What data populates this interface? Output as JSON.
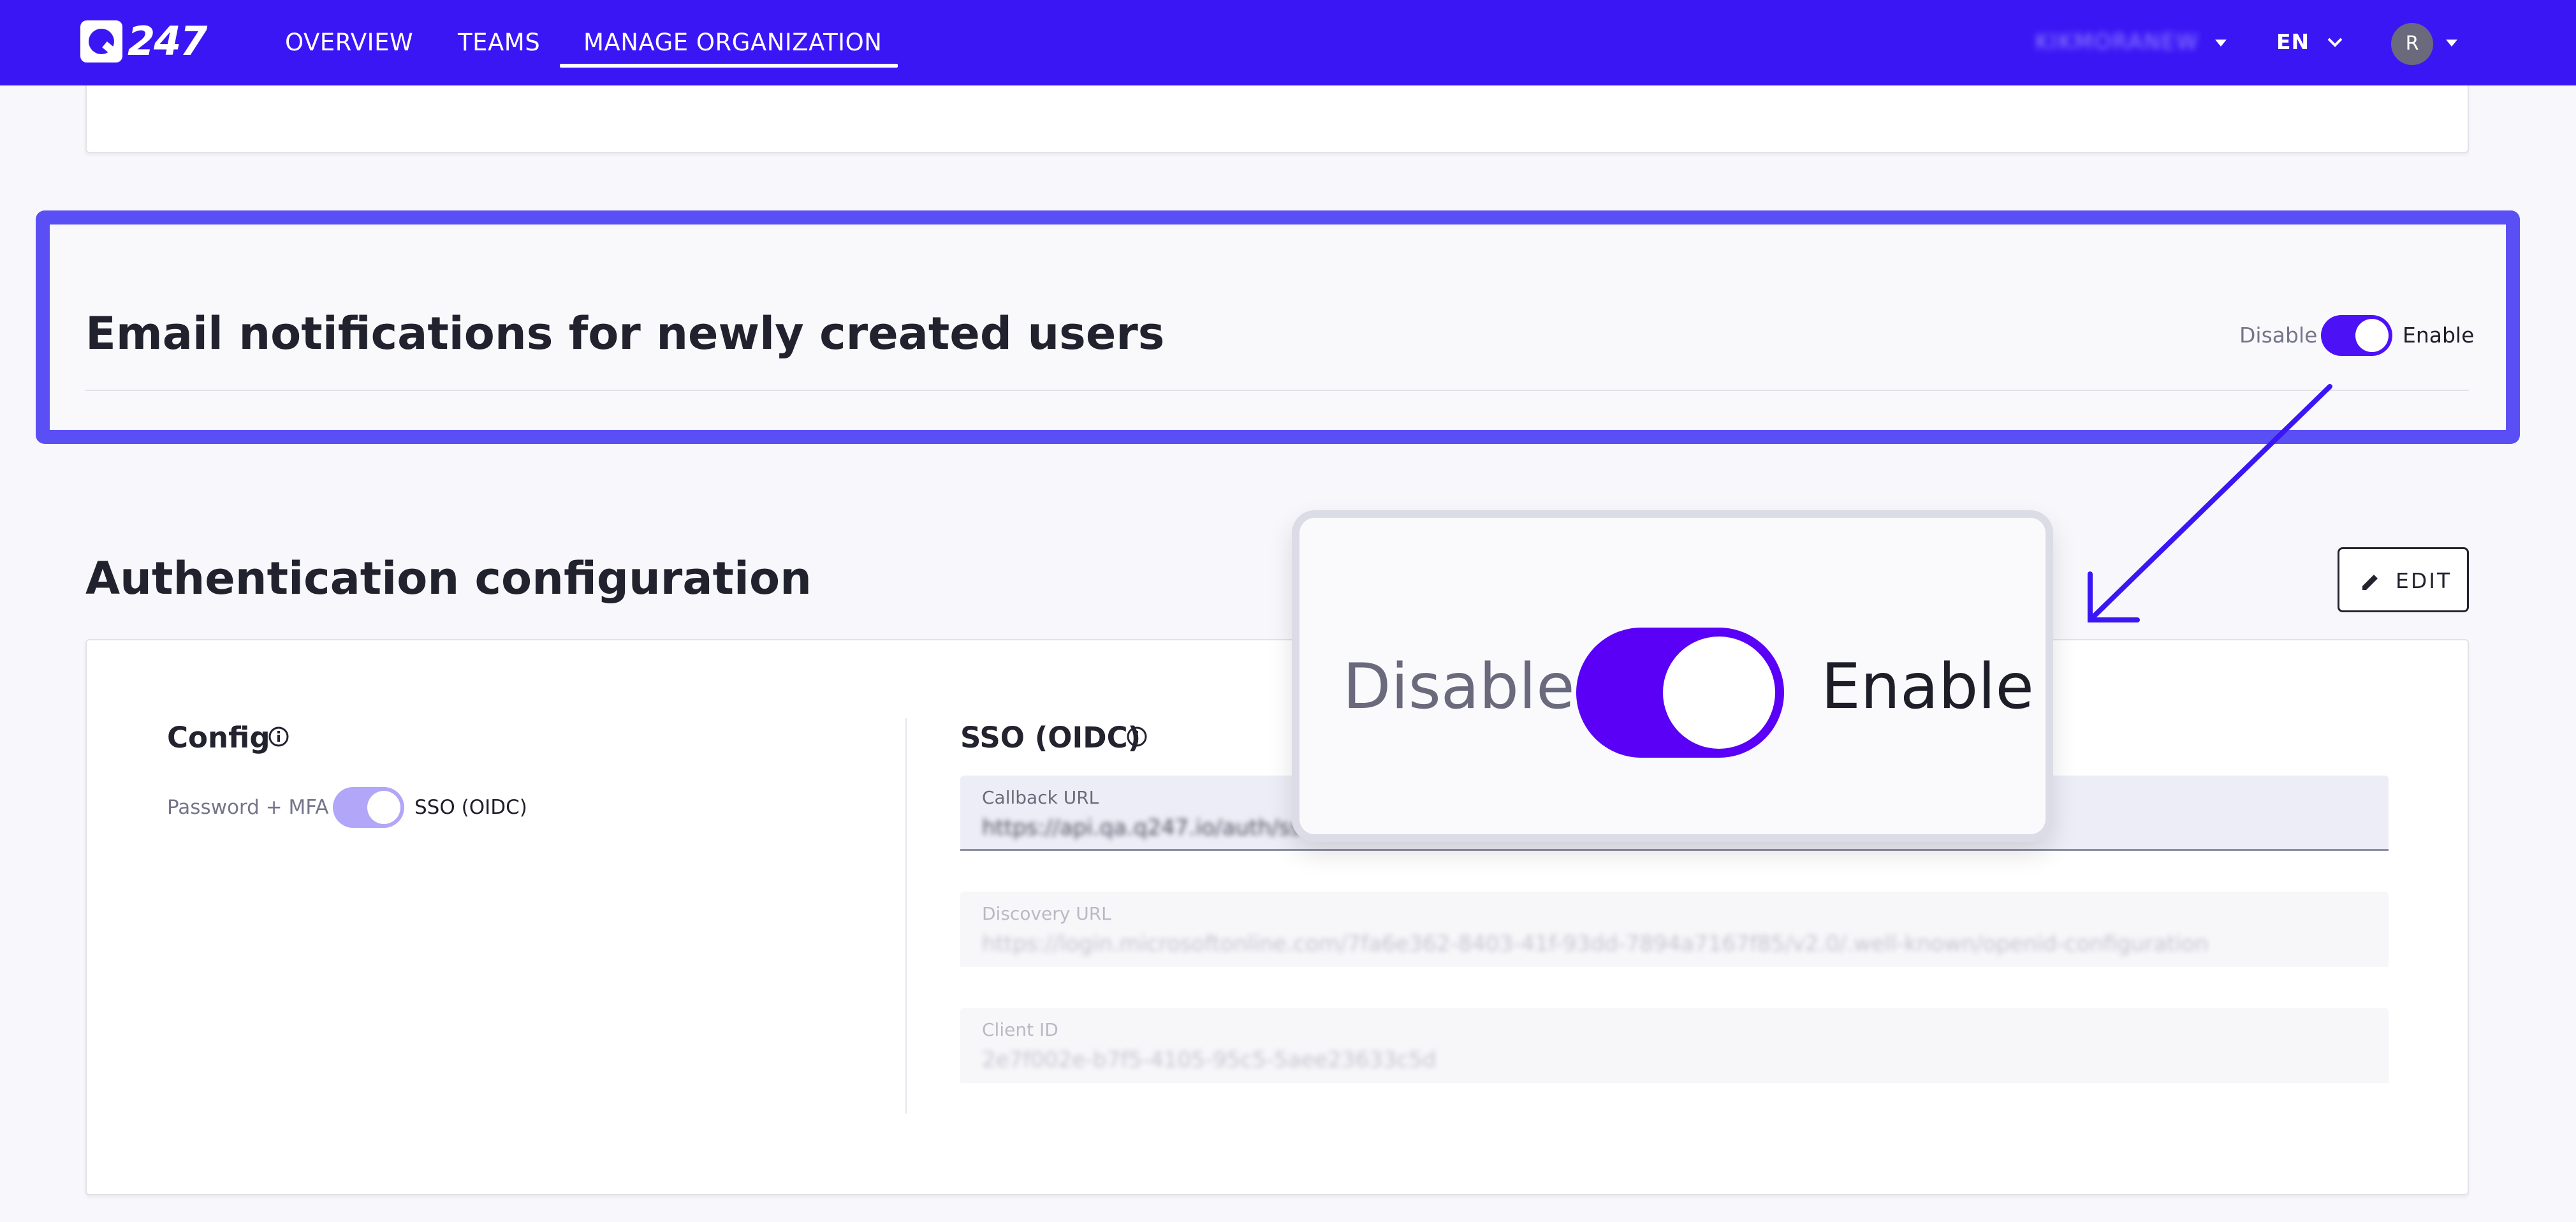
{
  "nav": {
    "logo_text": "247",
    "items": [
      "OVERVIEW",
      "TEAMS",
      "MANAGE ORGANIZATION"
    ],
    "active_index": 2,
    "org_name": "KIKMORANEW",
    "language": "EN",
    "avatar_initial": "R",
    "brand_color": "#3b16f5"
  },
  "email_section": {
    "title": "Email notifications for newly created users",
    "toggle": {
      "off_label": "Disable",
      "on_label": "Enable",
      "state": "on"
    },
    "highlight_color": "#5a4ff5"
  },
  "auth_section": {
    "title": "Authentication configuration",
    "edit_label": "EDIT",
    "config": {
      "title": "Config",
      "toggle_left": "Password + MFA",
      "toggle_right": "SSO (OIDC)",
      "state": "sso"
    },
    "sso": {
      "title": "SSO (OIDC)",
      "fields": [
        {
          "label": "Callback URL",
          "value": "https://api.qa.q247.io/auth/sso"
        },
        {
          "label": "Discovery URL",
          "value": "https://login.microsoftonline.com/7fa6e362-8403-41f-93dd-7894a7167f85/v2.0/.well-known/openid-configuration"
        },
        {
          "label": "Client ID",
          "value": "2e7f002e-b7f5-4105-95c5-5aee23633c5d"
        }
      ]
    }
  },
  "zoom_callout": {
    "off_label": "Disable",
    "on_label": "Enable",
    "toggle_color": "#5a00f6"
  }
}
